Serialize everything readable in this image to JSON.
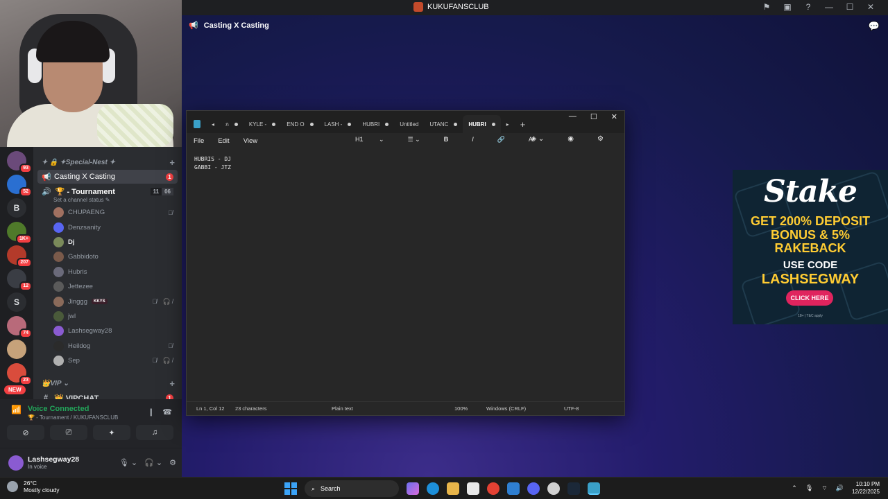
{
  "titlebar": {
    "app_name": "KUKUFANSCLUB"
  },
  "servers": [
    {
      "badge": "93",
      "color": "#6b4a7a"
    },
    {
      "badge": "52",
      "color": "#2a6fd1"
    },
    {
      "letter": "B"
    },
    {
      "badge": "1K+",
      "color": "#4f7a2a"
    },
    {
      "badge": "207",
      "color": "#b33a2a"
    },
    {
      "badge": "12",
      "color": "#3a3d44"
    },
    {
      "letter": "S"
    },
    {
      "badge": "74",
      "color": "#b86a7a"
    },
    {
      "badge": "",
      "color": "#c6a27a"
    },
    {
      "badge": "23",
      "color": "#d94c3c"
    }
  ],
  "new_badge": "NEW",
  "channels": {
    "category1": "✦ 🔒 ✦Special-Nest ✦",
    "active_channel": {
      "name": "Casting X Casting",
      "badge": "1"
    },
    "voice_channel": {
      "name": "🏆 - Tournament",
      "count_a": "11",
      "count_b": "06",
      "status": "Set a channel status ✎"
    },
    "members": [
      {
        "name": "CHUPAENG",
        "color": "#a07060",
        "muted": "🎙̸"
      },
      {
        "name": "Denzsanity",
        "color": "#5865f2",
        "muted": ""
      },
      {
        "name": "Dj",
        "color": "#7a8a5a",
        "muted": "",
        "speaking": true
      },
      {
        "name": "Gabbidoto",
        "color": "#7a5a4a",
        "muted": ""
      },
      {
        "name": "Hubris",
        "color": "#6a6a7a",
        "muted": ""
      },
      {
        "name": "Jettezee",
        "color": "#5a5a5a",
        "muted": ""
      },
      {
        "name": "Jinggg",
        "color": "#8a6a5a",
        "muted": "🎙̸ 🎧̸",
        "tag": "KKYS"
      },
      {
        "name": "jwl",
        "color": "#4a5a3a",
        "muted": ""
      },
      {
        "name": "Lashsegway28",
        "color": "#8a5bd1",
        "muted": ""
      },
      {
        "name": "Heildog",
        "color": "#2b2b2b",
        "muted": "🎙̸"
      },
      {
        "name": "Sep",
        "color": "#b0b0b0",
        "muted": "🎙̸ 🎧̸"
      }
    ],
    "category2": "👑VIP ⌄",
    "vipchat": "👑 VIPCHAT",
    "vipchat_badge": "1"
  },
  "voice_panel": {
    "title": "Voice Connected",
    "subtitle": "🏆 - Tournament / KUKUFANSCLUB"
  },
  "user": {
    "name": "Lashsegway28",
    "status": "In voice"
  },
  "main": {
    "channel_title": "Casting X Casting"
  },
  "notepad": {
    "tabs": [
      "KYLE -",
      "END O",
      "LASH -",
      "HUBRI",
      "Untitled",
      "UTANC",
      "HUBRI"
    ],
    "menu": [
      "File",
      "Edit",
      "View"
    ],
    "heading": "H1",
    "content": "HUBRIS - DJ\nGABBI - JTZ",
    "status": {
      "position": "Ln 1, Col 12",
      "chars": "23 characters",
      "format": "Plain text",
      "zoom": "100%",
      "eol": "Windows (CRLF)",
      "encoding": "UTF-8"
    }
  },
  "ad": {
    "logo": "Stake",
    "line1": "GET 200% DEPOSIT",
    "line2": "BONUS & 5%",
    "line3": "RAKEBACK",
    "line4": "USE CODE",
    "code": "LASHSEGWAY",
    "cta": "CLICK HERE",
    "fine": "18+ | T&C apply",
    "colors": {
      "gold": "#ffcc33",
      "cta": "#e0245e",
      "bg": "#0f2433"
    }
  },
  "taskbar": {
    "temp": "26°C",
    "weather": "Mostly cloudy",
    "search": "Search",
    "time": "10:10 PM",
    "date": "12/22/2025"
  }
}
